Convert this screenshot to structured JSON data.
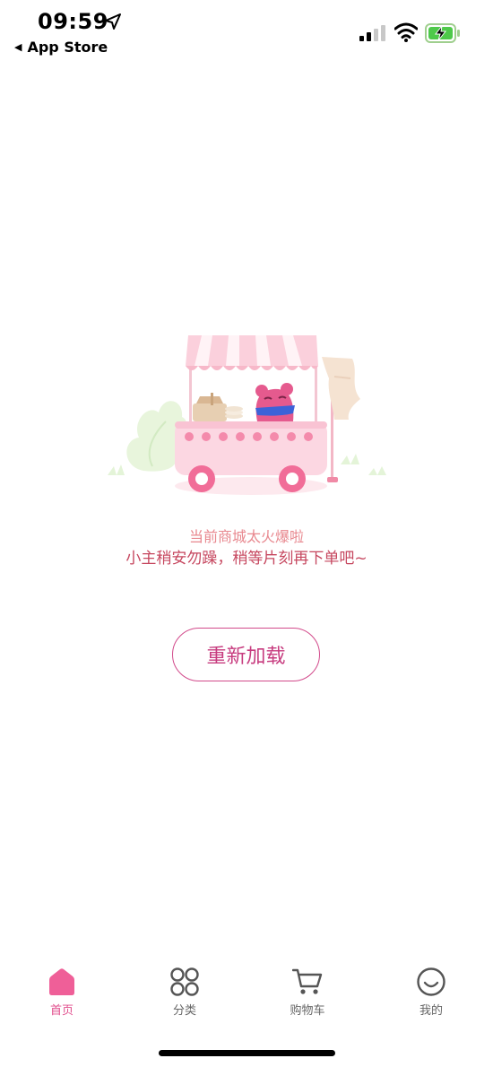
{
  "status_bar": {
    "time": "09:59",
    "back_app": "App Store",
    "location_icon": "location-arrow-icon",
    "signal_icon": "cellular-signal-icon",
    "wifi_icon": "wifi-icon",
    "battery_icon": "battery-charging-icon"
  },
  "illustration": {
    "icon": "food-cart-mascot-illustration"
  },
  "error": {
    "title": "当前商城太火爆啦",
    "subtitle": "小主稍安勿躁，稍等片刻再下单吧~"
  },
  "reload_button": {
    "label": "重新加载"
  },
  "tab_bar": {
    "tabs": [
      {
        "label": "首页",
        "icon": "home-icon",
        "active": true
      },
      {
        "label": "分类",
        "icon": "category-grid-icon",
        "active": false
      },
      {
        "label": "购物车",
        "icon": "shopping-cart-icon",
        "active": false
      },
      {
        "label": "我的",
        "icon": "smiley-face-icon",
        "active": false
      }
    ]
  },
  "colors": {
    "accent": "#e14d8c",
    "button_border": "#d24a8b",
    "title_text": "#e8888f",
    "subtitle_text": "#c6475f",
    "inactive_tab": "#666666"
  }
}
